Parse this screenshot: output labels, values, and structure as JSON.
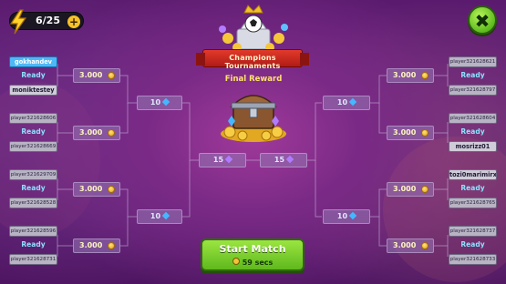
{
  "energy": {
    "count": "6/25",
    "icon": "lightning-bolt-icon",
    "plus_icon": "plus-icon"
  },
  "close": {
    "label": "✖",
    "icon": "close-icon"
  },
  "banner": {
    "title": "Champions Tournaments"
  },
  "final_reward": {
    "label": "Final Reward",
    "icon": "treasure-chest-icon"
  },
  "left_matches": [
    {
      "top": "gokhandev",
      "ready": "Ready",
      "bottom": "moniktestey",
      "prize": "3.000"
    },
    {
      "top": "player321628606",
      "ready": "Ready",
      "bottom": "player321628669",
      "prize": "3.000"
    },
    {
      "top": "player321629709",
      "ready": "Ready",
      "bottom": "player321628528",
      "prize": "3.000"
    },
    {
      "top": "player321628596",
      "ready": "Ready",
      "bottom": "player321628731",
      "prize": "3.000"
    }
  ],
  "right_matches": [
    {
      "top": "player321628621",
      "ready": "Ready",
      "bottom": "player321628797",
      "prize": "3.000"
    },
    {
      "top": "player321628604",
      "ready": "Ready",
      "bottom": "mosrizz01",
      "prize": "3.000"
    },
    {
      "top": "tozi0marimirx",
      "ready": "Ready",
      "bottom": "player321628765",
      "prize": "3.000"
    },
    {
      "top": "player321628737",
      "ready": "Ready",
      "bottom": "player321628733",
      "prize": "3.000"
    }
  ],
  "semi_rewards": {
    "left_top": "10",
    "left_bottom": "10",
    "right_top": "10",
    "right_bottom": "10"
  },
  "final_rewards": {
    "left": "15",
    "right": "15"
  },
  "start": {
    "label": "Start Match",
    "timer": "59 secs"
  },
  "colors": {
    "accent_green": "#6cc425",
    "player_highlight": "#4fb8f6",
    "ready_text": "#8de1ff",
    "prize_text": "#fff6c0",
    "banner_red": "#d32a20"
  }
}
